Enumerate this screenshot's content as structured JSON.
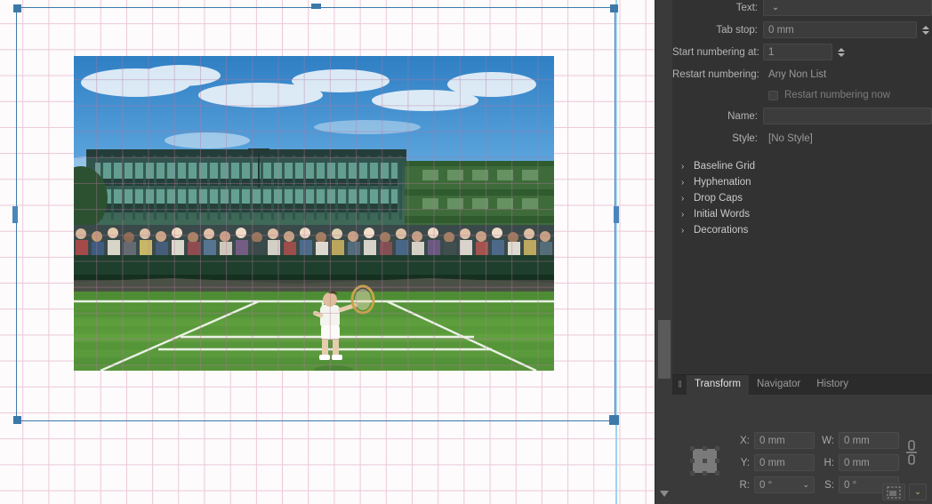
{
  "canvas": {
    "guide_color": "#9fd3ef",
    "grid_color": "#e9bfd2",
    "selection_color": "#3c79a8",
    "image_alt": "tennis-court-photo"
  },
  "paragraph_panel": {
    "rows": [
      {
        "label": "Text:",
        "value": "",
        "control": "dropdown"
      },
      {
        "label": "Tab stop:",
        "value": "0 mm",
        "control": "spinner"
      },
      {
        "label": "Start numbering at:",
        "value": "1",
        "control": "spinner"
      },
      {
        "label": "Restart numbering:",
        "value": "Any Non List",
        "control": "plain"
      }
    ],
    "checkbox": {
      "label": "Restart numbering now",
      "checked": false
    },
    "name_row": {
      "label": "Name:",
      "value": "",
      "placeholder": ""
    },
    "style_row": {
      "label": "Style:",
      "value": "[No Style]"
    },
    "sections": [
      {
        "label": "Baseline Grid",
        "expanded": false
      },
      {
        "label": "Hyphenation",
        "expanded": false
      },
      {
        "label": "Drop Caps",
        "expanded": false
      },
      {
        "label": "Initial Words",
        "expanded": false
      },
      {
        "label": "Decorations",
        "expanded": false
      }
    ],
    "arrow_glyph": "›"
  },
  "transform_dock": {
    "tabs": [
      {
        "label": "Transform",
        "active": true
      },
      {
        "label": "Navigator",
        "active": false
      },
      {
        "label": "History",
        "active": false
      }
    ],
    "fields": {
      "x": {
        "label": "X:",
        "value": "0 mm"
      },
      "y": {
        "label": "Y:",
        "value": "0 mm"
      },
      "w": {
        "label": "W:",
        "value": "0 mm"
      },
      "h": {
        "label": "H:",
        "value": "0 mm"
      },
      "r": {
        "label": "R:",
        "value": "0 °"
      },
      "s": {
        "label": "S:",
        "value": "0 °"
      }
    },
    "chevron": "⌄",
    "grip": "‖"
  }
}
